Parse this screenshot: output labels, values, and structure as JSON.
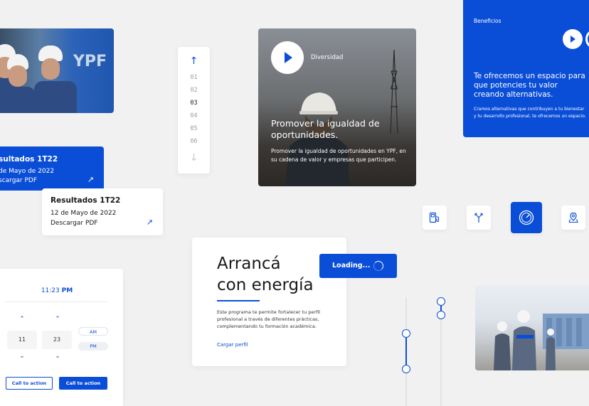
{
  "results_card_blue": {
    "title": "sultados 1T22",
    "date": "de Mayo de 2022",
    "link": "scargar PDF",
    "arrow": "↗"
  },
  "results_card_white": {
    "title": "Resultados 1T22",
    "date": "12 de Mayo de 2022",
    "link": "Descargar PDF",
    "arrow": "↗"
  },
  "pager": {
    "up_arrow": "↑",
    "down_arrow": "↓",
    "pages": [
      "01",
      "02",
      "03",
      "04",
      "05",
      "06"
    ],
    "active_page": "03"
  },
  "video_card": {
    "tag": "Diversidad",
    "heading": "Promover la igualdad de oportunidades.",
    "body": "Promover la igualdad de oportunidades en YPF, en su cadena de valor y empresas que participen."
  },
  "benefits_card": {
    "label": "Beneficios",
    "heading": "Te ofrecemos un espacio para que potencies tu valor creando alternativas.",
    "body": "Cramos alternativas que contribuyen a tu bienestar y tu desarrollo profesional, te ofrecemos un espacio."
  },
  "photo1": {
    "logo_text": "YPF"
  },
  "icon_tiles": [
    {
      "icon": "fuel-pump-icon"
    },
    {
      "icon": "road-fork-icon"
    },
    {
      "icon": "speedometer-icon",
      "selected": true
    },
    {
      "icon": "map-pin-icon"
    }
  ],
  "time_picker": {
    "time": "11:23",
    "meridiem": "PM",
    "hour": "11",
    "minute": "23",
    "am_label": "AM",
    "pm_label": "PM",
    "up_chevron": "⌃",
    "down_chevron": "⌄",
    "secondary_button": "Call to action",
    "primary_button": "Call to action"
  },
  "main_card": {
    "title_line1": "Arrancá",
    "title_line2": "con energía",
    "body": "Este programa te permite fortalecer tu perfil profesional a través de diferentes prácticas, complementando tu formación académica.",
    "link": "Cargar perfil"
  },
  "loading_button": {
    "label": "Loading..."
  },
  "colors": {
    "accent": "#0a4ed8",
    "background": "#f1f1f2"
  }
}
